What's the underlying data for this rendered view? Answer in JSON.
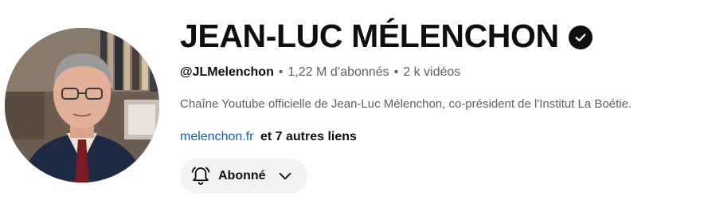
{
  "channel": {
    "name": "JEAN-LUC MÉLENCHON",
    "handle": "@JLMelenchon",
    "subscribers": "1,22 M d’abonnés",
    "videos": "2 k vidéos",
    "separator": "•",
    "description": "Chaîne Youtube officielle de Jean-Luc Mélenchon, co-président de l'Institut La Boétie.",
    "link": "melenchon.fr",
    "more_links": "et 7 autres liens",
    "verified_icon": "verified-check-icon"
  },
  "subscribe_button": {
    "label": "Abonné",
    "icon": "bell-icon",
    "dropdown_icon": "chevron-down-icon"
  },
  "colors": {
    "link": "#065fd4",
    "secondary_text": "#606060",
    "button_bg": "#f2f2f2"
  }
}
